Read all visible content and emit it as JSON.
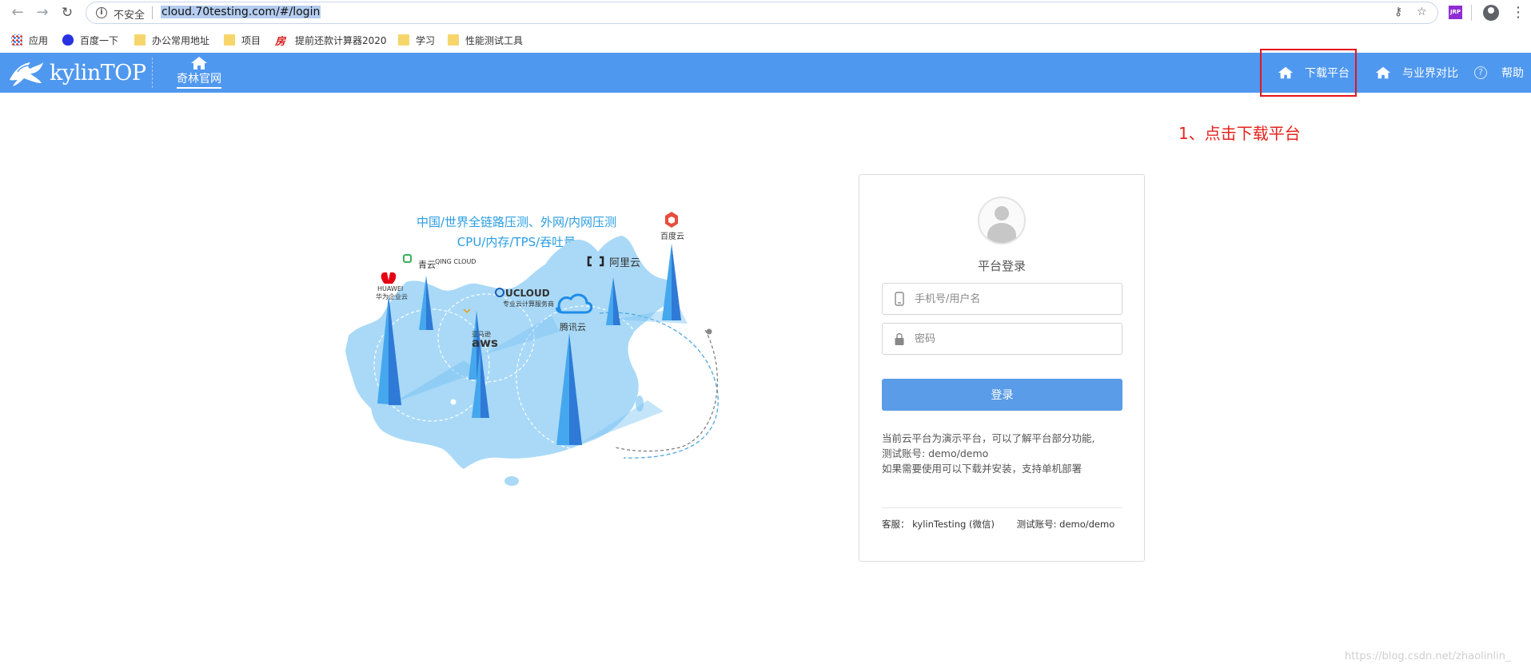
{
  "browser": {
    "insecure_label": "不安全",
    "url": "cloud.70testing.com/#/login",
    "bookmarks": [
      {
        "label": "应用"
      },
      {
        "label": "百度一下"
      },
      {
        "label": "办公常用地址"
      },
      {
        "label": "项目"
      },
      {
        "label": "提前还款计算器2020"
      },
      {
        "label": "学习"
      },
      {
        "label": "性能测试工具"
      }
    ],
    "extension_label": "JRP"
  },
  "header": {
    "logo_text": "kylinTOP",
    "home_link": "奇林官网",
    "nav": [
      {
        "label": "下载平台"
      },
      {
        "label": "与业界对比"
      },
      {
        "label": "帮助"
      }
    ]
  },
  "annotation": "1、点击下载平台",
  "illustration": {
    "line1": "中国/世界全链路压测、外网/内网压测",
    "line2": "CPU/内存/TPS/吞吐量",
    "brands": {
      "qingyun": "青云",
      "qingyun_en": "QING CLOUD",
      "huawei": "HUAWEI",
      "huawei_cloud": "华为企业云",
      "ucloud": "UCLOUD",
      "ucloud_sub": "专业云计算服务商",
      "aws_cn": "亚马逊",
      "aws": "aws",
      "tencent": "腾讯云",
      "aliyun": "阿里云",
      "baidu": "百度云"
    }
  },
  "login": {
    "title": "平台登录",
    "username_placeholder": "手机号/用户名",
    "password_placeholder": "密码",
    "submit": "登录",
    "notice": [
      "当前云平台为演示平台，可以了解平台部分功能,",
      "测试账号: demo/demo",
      "如果需要使用可以下载并安装，支持单机部署"
    ],
    "support": "客服： kylinTesting (微信)",
    "test_account": "测试账号: demo/demo"
  },
  "watermark": "https://blog.csdn.net/zhaolinlin_",
  "colors": {
    "header_bg": "#4f98ef",
    "login_button": "#5a9ce8",
    "annotation": "#e8231d",
    "map_fill": "#a9d9f7"
  }
}
